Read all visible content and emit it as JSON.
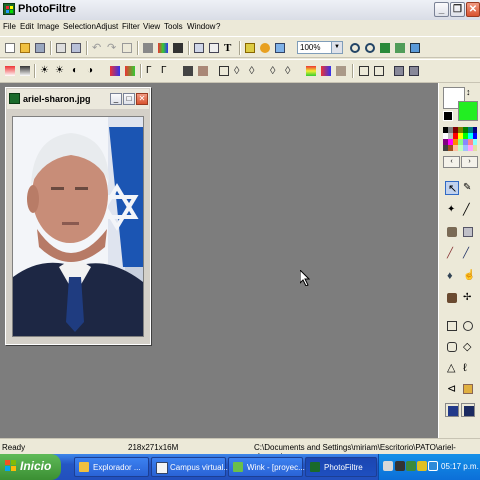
{
  "titlebar": {
    "title": "PhotoFiltre"
  },
  "menu": {
    "items": [
      "File",
      "Edit",
      "Image",
      "Selection",
      "Adjust",
      "Filter",
      "View",
      "Tools",
      "Window",
      "?"
    ]
  },
  "toolbar": {
    "zoom": "100%"
  },
  "document": {
    "title": "ariel-sharon.jpg"
  },
  "status": {
    "left": "Ready",
    "size": "218x271x16M",
    "path": "C:\\Documents and Settings\\miriam\\Escritorio\\PATO\\ariel-sharon.jpg"
  },
  "taskbar": {
    "start": "Inicio",
    "tasks": [
      "Explorador ...",
      "Campus virtual...",
      "Wink - [proyec...",
      "PhotoFiltre"
    ],
    "time": "05:17 p.m."
  },
  "palette": {
    "primary": "#ffffff",
    "secondary": "#22ee22"
  }
}
